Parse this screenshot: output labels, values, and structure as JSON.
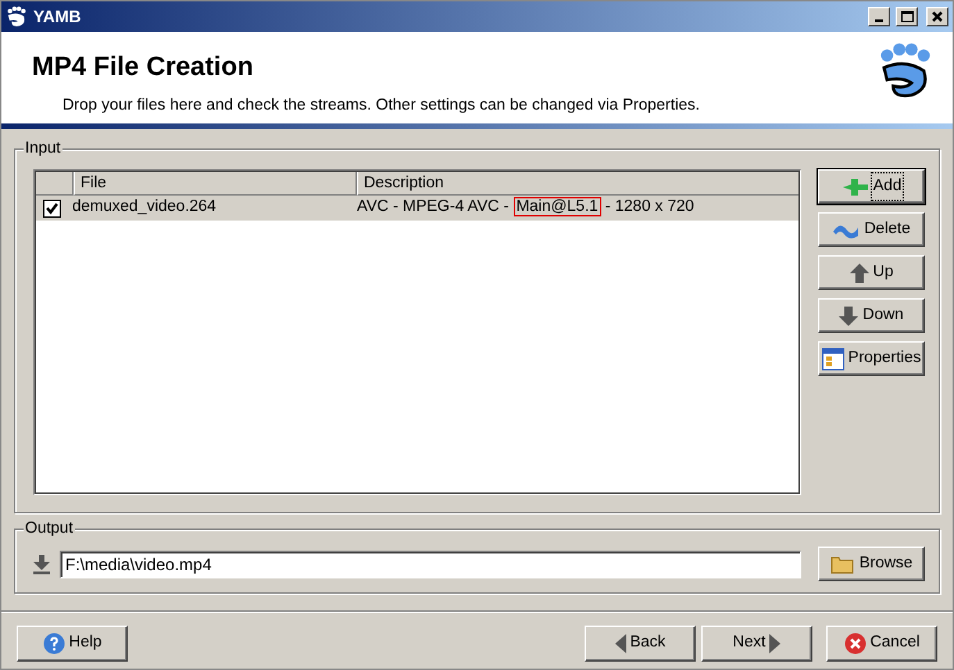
{
  "window": {
    "title": "YAMB"
  },
  "header": {
    "title": "MP4 File Creation",
    "subtitle": "Drop your files here and check the streams. Other settings can be changed via Properties."
  },
  "input": {
    "label": "Input",
    "columns": [
      "File",
      "Description"
    ],
    "rows": [
      {
        "checked": true,
        "selected": true,
        "file": "demuxed_video.264",
        "description": [
          {
            "text": "AVC - MPEG-4 AVC - ",
            "highlighted": false
          },
          {
            "text": "Main@L5.1",
            "highlighted": true
          },
          {
            "text": " - 1280 x 720",
            "highlighted": false
          }
        ]
      }
    ],
    "buttons": [
      {
        "kind": "add",
        "label": "Add",
        "focused": true
      },
      {
        "kind": "delete",
        "label": "Delete",
        "focused": false
      },
      {
        "kind": "up",
        "label": "Up",
        "focused": false
      },
      {
        "kind": "down",
        "label": "Down",
        "focused": false
      },
      {
        "kind": "properties",
        "label": "Properties",
        "focused": false
      }
    ]
  },
  "output": {
    "label": "Output",
    "path": "F:\\media\\video.mp4",
    "browse": "Browse"
  },
  "footer": {
    "help": "Help",
    "back": "Back",
    "next": "Next",
    "cancel": "Cancel"
  }
}
